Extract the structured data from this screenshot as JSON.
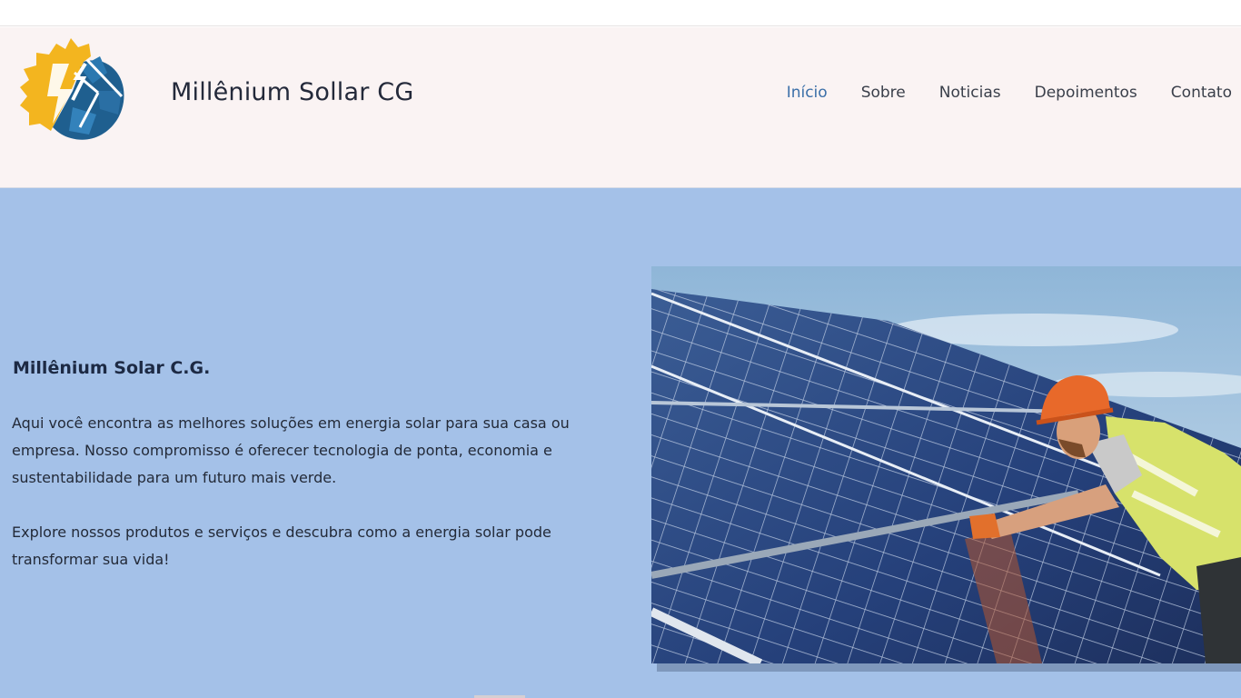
{
  "header": {
    "brand": "Millênium Sollar CG",
    "logo_icon": "solar-bolt-logo-icon",
    "nav": [
      {
        "label": "Início",
        "active": true
      },
      {
        "label": "Sobre",
        "active": false
      },
      {
        "label": "Noticias",
        "active": false
      },
      {
        "label": "Depoimentos",
        "active": false
      },
      {
        "label": "Contato",
        "active": false
      }
    ]
  },
  "hero": {
    "title": "Millênium Solar C.G.",
    "paragraph1": "Aqui você encontra as melhores soluções em energia solar para sua casa ou empresa. Nosso compromisso é oferecer tecnologia de ponta, economia e sustentabilidade para um futuro mais verde.",
    "paragraph2": "Explore nossos produtos e serviços e descubra como a energia solar pode transformar sua vida!",
    "image_icon": "solar-panel-worker-photo"
  },
  "colors": {
    "header_bg": "#faf3f3",
    "hero_bg": "#a4c1e8",
    "nav_active": "#3b6fa8",
    "logo_yellow": "#f2b01e",
    "logo_blue": "#1f5f8f"
  }
}
